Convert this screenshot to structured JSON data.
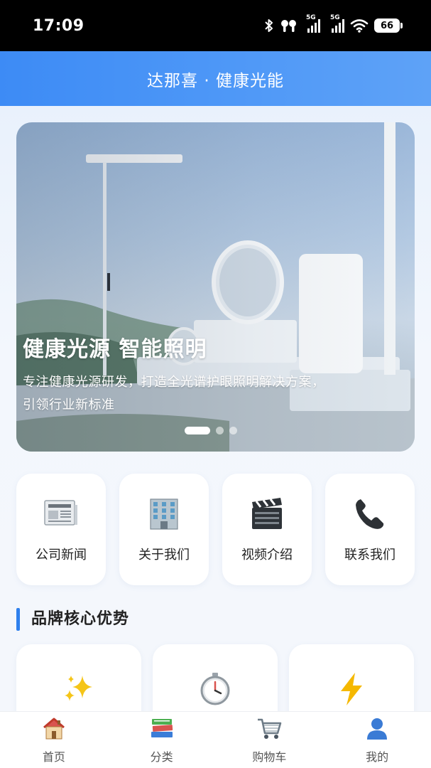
{
  "status_bar": {
    "time": "17:09",
    "network_1": "5G",
    "network_2": "5G",
    "battery": "66",
    "icons": [
      "bluetooth-icon",
      "earbuds-icon",
      "signal-icon",
      "signal-icon",
      "wifi-icon",
      "battery-icon"
    ]
  },
  "header": {
    "title": "达那喜 · 健康光能"
  },
  "banner": {
    "title": "健康光源 智能照明",
    "description": "专注健康光源研发，打造全光谱护眼照明解决方案，引领行业新标准",
    "slide_count": 3,
    "active_slide": 1
  },
  "quick_nav": [
    {
      "label": "公司新闻",
      "icon": "newspaper-icon"
    },
    {
      "label": "关于我们",
      "icon": "office-building-icon"
    },
    {
      "label": "视频介绍",
      "icon": "clapperboard-icon"
    },
    {
      "label": "联系我们",
      "icon": "telephone-icon"
    }
  ],
  "section": {
    "title": "品牌核心优势"
  },
  "advantages": [
    {
      "icon": "sparkles-icon"
    },
    {
      "icon": "stopwatch-icon"
    },
    {
      "icon": "lightning-icon"
    }
  ],
  "tab_bar": {
    "tabs": [
      {
        "label": "首页",
        "icon": "house-icon"
      },
      {
        "label": "分类",
        "icon": "books-icon"
      },
      {
        "label": "购物车",
        "icon": "shopping-cart-icon"
      },
      {
        "label": "我的",
        "icon": "user-icon"
      }
    ]
  },
  "colors": {
    "accent": "#2f80ed",
    "header_gradient_start": "#3d8bf5",
    "header_gradient_end": "#5ea2f7",
    "page_bg": "#f2f6fc"
  }
}
